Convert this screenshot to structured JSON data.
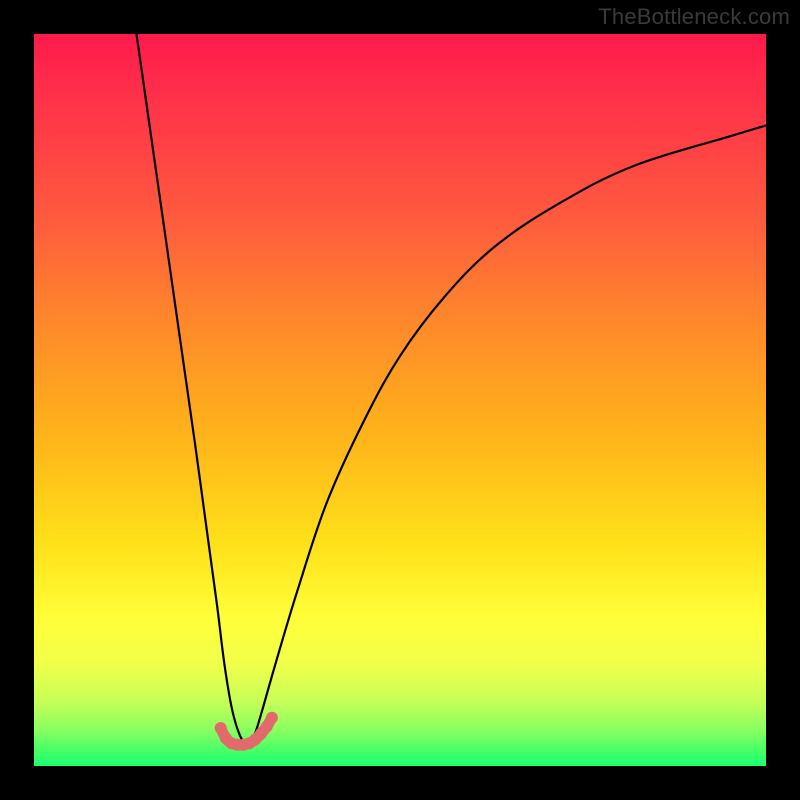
{
  "watermark": "TheBottleneck.com",
  "chart_data": {
    "type": "line",
    "title": "",
    "xlabel": "",
    "ylabel": "",
    "xlim": [
      0,
      100
    ],
    "ylim": [
      0,
      100
    ],
    "series": [
      {
        "name": "main-curve",
        "x": [
          14,
          16,
          18,
          20,
          22,
          23.5,
          25,
          26,
          27,
          28,
          29,
          30,
          31,
          33,
          36,
          40,
          45,
          50,
          56,
          63,
          72,
          82,
          95,
          100
        ],
        "values": [
          100,
          86,
          72,
          58,
          44,
          33,
          22,
          14,
          8,
          4.5,
          3,
          4,
          7,
          14,
          24,
          36,
          47,
          56,
          64,
          71,
          77,
          82,
          86,
          87.5
        ]
      },
      {
        "name": "marker-band",
        "x": [
          25.5,
          26.2,
          27.0,
          27.8,
          28.6,
          29.4,
          30.2,
          31.0,
          31.8,
          32.5
        ],
        "values": [
          5.2,
          3.8,
          3.1,
          2.9,
          2.9,
          3.1,
          3.6,
          4.4,
          5.4,
          6.6
        ]
      }
    ],
    "marker_color": "#e26a6a",
    "curve_color": "#000000",
    "background_gradient": [
      "#ff1a4c",
      "#ff8a2a",
      "#ffe21a",
      "#1aff70"
    ]
  }
}
